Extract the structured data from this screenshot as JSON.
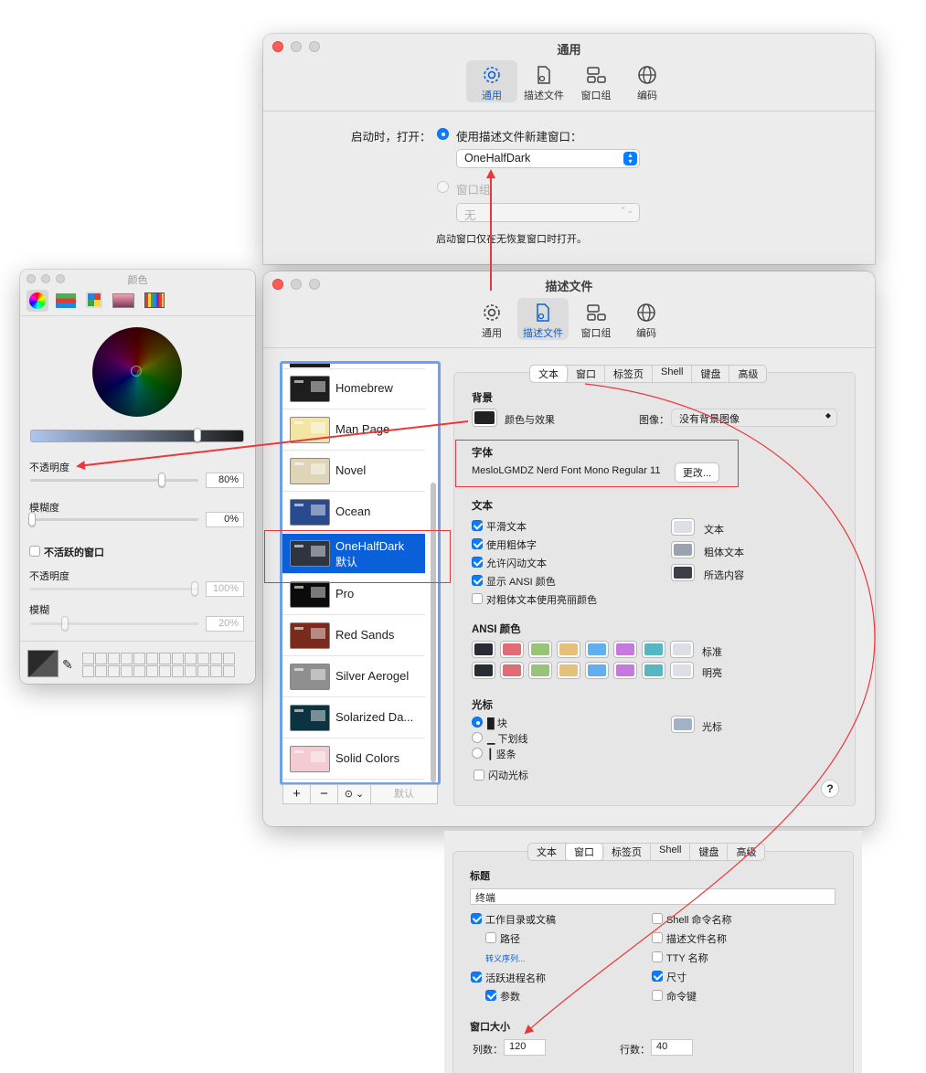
{
  "general_window": {
    "title": "通用",
    "toolbar": [
      "通用",
      "描述文件",
      "窗口组",
      "编码"
    ],
    "startup_label": "启动时，打开：",
    "new_window_option": "使用描述文件新建窗口：",
    "profile_select": "OneHalfDark",
    "window_group_option": "窗口组",
    "window_group_select": "无",
    "note": "启动窗口仅在无恢复窗口时打开。"
  },
  "profiles_window": {
    "title": "描述文件",
    "toolbar": [
      "通用",
      "描述文件",
      "窗口组",
      "编码"
    ],
    "profiles": [
      {
        "name": "Homebrew",
        "color": "#1e1e1e"
      },
      {
        "name": "Man Page",
        "color": "#f3e6a5"
      },
      {
        "name": "Novel",
        "color": "#dfd4b6"
      },
      {
        "name": "Ocean",
        "color": "#2a4a8f"
      },
      {
        "name": "OneHalfDark",
        "subtitle": "默认",
        "color": "#2e3440"
      },
      {
        "name": "Pro",
        "color": "#0b0b0b"
      },
      {
        "name": "Red Sands",
        "color": "#7a2b1e"
      },
      {
        "name": "Silver Aerogel",
        "color": "#8f8f8f"
      },
      {
        "name": "Solarized Da...",
        "color": "#0b3440"
      },
      {
        "name": "Solid Colors",
        "color": "#f4cbd3"
      }
    ],
    "list_buttons": [
      "+",
      "−",
      "⊙ ⌄",
      "默认"
    ],
    "tabs": [
      "文本",
      "窗口",
      "标签页",
      "Shell",
      "键盘",
      "高级"
    ],
    "background_heading": "背景",
    "color_effects": "颜色与效果",
    "image_label": "图像：",
    "image_select": "没有背景图像",
    "font_heading": "字体",
    "font_name": "MesloLGMDZ Nerd Font Mono Regular 11",
    "change_button": "更改...",
    "text_heading": "文本",
    "text_options": [
      {
        "label": "平滑文本",
        "checked": true
      },
      {
        "label": "使用粗体字",
        "checked": true
      },
      {
        "label": "允许闪动文本",
        "checked": true
      },
      {
        "label": "显示 ANSI 颜色",
        "checked": true
      },
      {
        "label": "对粗体文本使用亮丽颜色",
        "checked": false
      }
    ],
    "text_colors": [
      {
        "label": "文本",
        "color": "#dcdfe4"
      },
      {
        "label": "粗体文本",
        "color": "#9aa3ad"
      },
      {
        "label": "所选内容",
        "color": "#3b4048"
      }
    ],
    "ansi_heading": "ANSI 颜色",
    "ansi_normal_label": "标准",
    "ansi_bright_label": "明亮",
    "ansi_normal": [
      "#282c34",
      "#e06c75",
      "#98c379",
      "#e5c07b",
      "#61afef",
      "#c678dd",
      "#56b6c2",
      "#dcdfe4"
    ],
    "ansi_bright": [
      "#282c34",
      "#e06c75",
      "#98c379",
      "#e5c07b",
      "#61afef",
      "#c678dd",
      "#56b6c2",
      "#dcdfe4"
    ],
    "cursor_heading": "光标",
    "cursor_options": [
      {
        "label": "█ 块",
        "checked": true
      },
      {
        "label": "▁ 下划线",
        "checked": false
      },
      {
        "label": "┃ 竖条",
        "checked": false
      }
    ],
    "blink_cursor": "闪动光标",
    "cursor_color_label": "光标",
    "cursor_color": "#a3b1c7",
    "help": "?"
  },
  "color_panel": {
    "title": "颜色",
    "opacity_label": "不透明度",
    "opacity_value": "80%",
    "blur_label": "模糊度",
    "blur_value": "0%",
    "inactive_label": "不活跃的窗口",
    "inactive_opacity_label": "不透明度",
    "inactive_opacity_value": "100%",
    "inactive_blur_label": "模糊",
    "inactive_blur_value": "20%",
    "wheel_brightness": 0.3,
    "opacity_level": 0.8,
    "blur_level": 0.0,
    "inactive_opacity_level": 1.0,
    "inactive_blur_level": 0.2
  },
  "window_tab_pane": {
    "tabs": [
      "文本",
      "窗口",
      "标签页",
      "Shell",
      "键盘",
      "高级"
    ],
    "title_heading": "标题",
    "title_value": "终端",
    "left_options": [
      {
        "label": "工作目录或文稿",
        "checked": true,
        "indent": false
      },
      {
        "label": "路径",
        "checked": false,
        "indent": true
      }
    ],
    "escape_link": "转义序列...",
    "left_options2": [
      {
        "label": "活跃进程名称",
        "checked": true,
        "indent": false
      },
      {
        "label": "参数",
        "checked": true,
        "indent": true
      }
    ],
    "right_options": [
      {
        "label": "Shell 命令名称",
        "checked": false
      },
      {
        "label": "描述文件名称",
        "checked": false
      },
      {
        "label": "TTY 名称",
        "checked": false
      },
      {
        "label": "尺寸",
        "checked": true
      },
      {
        "label": "命令键",
        "checked": false
      }
    ],
    "size_heading": "窗口大小",
    "columns_label": "列数：",
    "columns_value": "120",
    "rows_label": "行数：",
    "rows_value": "40"
  }
}
